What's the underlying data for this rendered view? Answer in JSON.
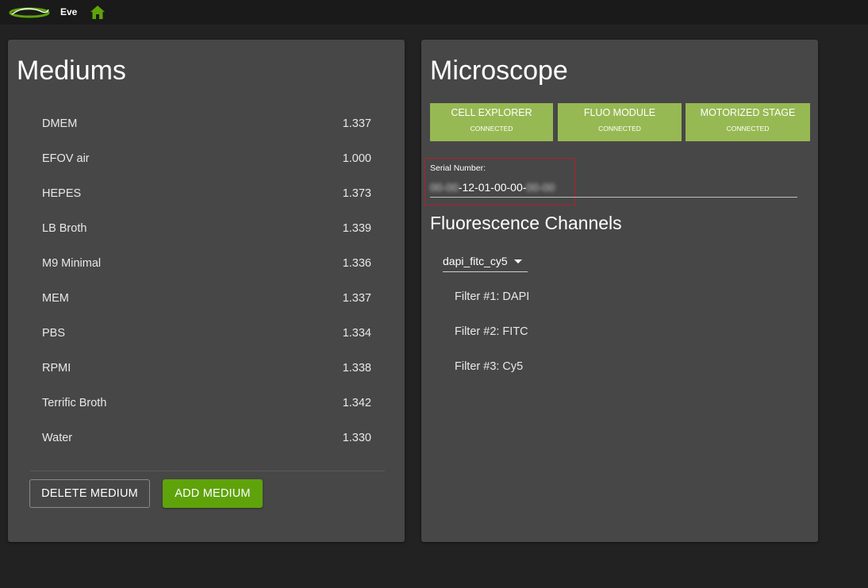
{
  "app": {
    "name": "Eve",
    "logo_icon": "eve-logo-icon",
    "home_icon": "home-icon",
    "accent": "#5fa30b"
  },
  "mediums": {
    "title": "Mediums",
    "items": [
      {
        "name": "DMEM",
        "value": "1.337"
      },
      {
        "name": "EFOV air",
        "value": "1.000"
      },
      {
        "name": "HEPES",
        "value": "1.373"
      },
      {
        "name": "LB Broth",
        "value": "1.339"
      },
      {
        "name": "M9 Minimal",
        "value": "1.336"
      },
      {
        "name": "MEM",
        "value": "1.337"
      },
      {
        "name": "PBS",
        "value": "1.334"
      },
      {
        "name": "RPMI",
        "value": "1.338"
      },
      {
        "name": "Terrific Broth",
        "value": "1.342"
      },
      {
        "name": "Water",
        "value": "1.330"
      }
    ],
    "delete_label": "DELETE MEDIUM",
    "add_label": "ADD MEDIUM"
  },
  "microscope": {
    "title": "Microscope",
    "modules": [
      {
        "label": "CELL EXPLORER",
        "status": "CONNECTED"
      },
      {
        "label": "FLUO MODULE",
        "status": "CONNECTED"
      },
      {
        "label": "MOTORIZED STAGE",
        "status": "CONNECTED"
      }
    ],
    "module_color": "#97b953",
    "serial_label": "Serial Number:",
    "serial_prefix_blurred": "00-00",
    "serial_visible": "-12-01-00-00-",
    "serial_suffix_blurred": "00-00",
    "fluorescence_title": "Fluorescence Channels",
    "channel_set": "dapi_fitc_cy5",
    "filters": [
      "Filter #1: DAPI",
      "Filter #2: FITC",
      "Filter #3: Cy5"
    ]
  }
}
